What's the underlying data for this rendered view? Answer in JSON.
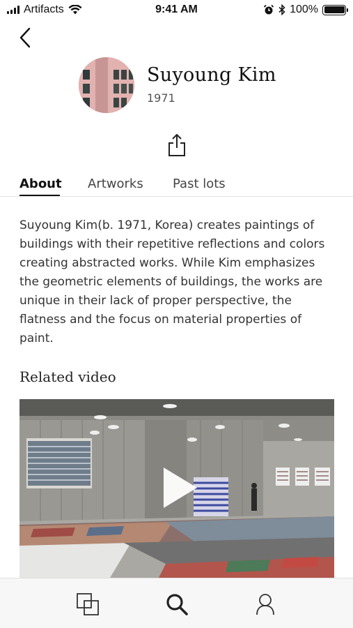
{
  "status_bar": {
    "carrier": "Artifacts",
    "time": "9:41 AM",
    "battery": "100%",
    "icons": [
      "signal-icon",
      "wifi-icon",
      "alarm-icon",
      "bluetooth-icon",
      "battery-icon"
    ],
    "battery_level": 1.0
  },
  "nav": {
    "back_icon": "chevron-left-icon"
  },
  "artist": {
    "name": "Suyoung Kim",
    "year": "1971"
  },
  "share": {
    "icon": "share-icon"
  },
  "tabs": [
    {
      "label": "About",
      "active": true
    },
    {
      "label": "Artworks",
      "active": false
    },
    {
      "label": "Past lots",
      "active": false
    }
  ],
  "about": {
    "text": "Suyoung Kim(b. 1971, Korea) creates paintings of buildings with their repetitive reflections and colors creating abstracted works. While Kim emphasizes the geometric elements of buildings, the works are unique in their lack of proper perspective, the flatness and the focus on material properties of paint."
  },
  "related_video": {
    "title": "Related video",
    "play_icon": "play-icon"
  },
  "tab_bar": {
    "items": [
      {
        "icon": "collection-icon"
      },
      {
        "icon": "search-icon"
      },
      {
        "icon": "profile-icon"
      }
    ]
  },
  "colors": {
    "accent": "#111111",
    "avatar_pink": "#d9a7a6",
    "tab_bar_bg": "#f7f7f7"
  }
}
